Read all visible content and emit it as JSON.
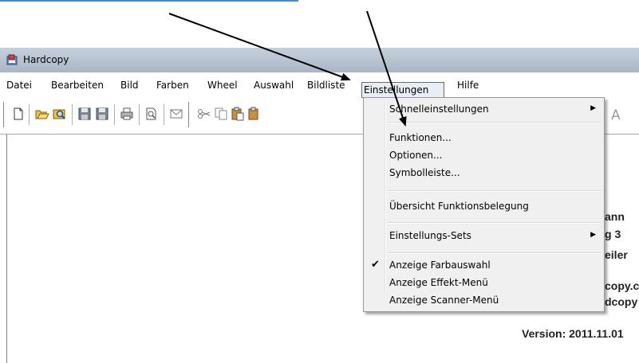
{
  "window": {
    "title": "Hardcopy"
  },
  "menubar": {
    "items": [
      "Datei",
      "Bearbeiten",
      "Bild",
      "Farben",
      "Wheel",
      "Auswahl",
      "Bildliste",
      "Einstellungen",
      "Hilfe"
    ]
  },
  "toolbar": {
    "buttons": [
      "new-icon",
      "open-icon",
      "browse-icon",
      "save-icon",
      "save-as-icon",
      "print-icon",
      "print-preview-icon",
      "mail-icon",
      "cut-icon",
      "copy-icon",
      "paste-icon",
      "text-icon"
    ],
    "text_tool_label": "A"
  },
  "info": {
    "line1": "ann",
    "line2": "g 3",
    "line3": "eiler",
    "line4": "copy.c",
    "line5": "dcopy",
    "version": "Version: 2011.11.01"
  },
  "dropdown": {
    "items": [
      {
        "label": "Schnelleinstellungen",
        "submenu": true
      },
      {
        "label": "Funktionen..."
      },
      {
        "label": "Optionen..."
      },
      {
        "label": "Symbolleiste..."
      },
      {
        "label": "Übersicht Funktionsbelegung"
      },
      {
        "label": "Einstellungs-Sets",
        "submenu": true
      },
      {
        "label": "Anzeige Farbauswahl",
        "checked": true
      },
      {
        "label": "Anzeige Effekt-Menü"
      },
      {
        "label": "Anzeige Scanner-Menü"
      }
    ],
    "submenu_glyph": "▶",
    "check_glyph": "✔"
  },
  "colors": {
    "accent": "#3a8fd6",
    "menu_bg": "#f0f0f0",
    "titlebar": "#b8c4d2"
  }
}
